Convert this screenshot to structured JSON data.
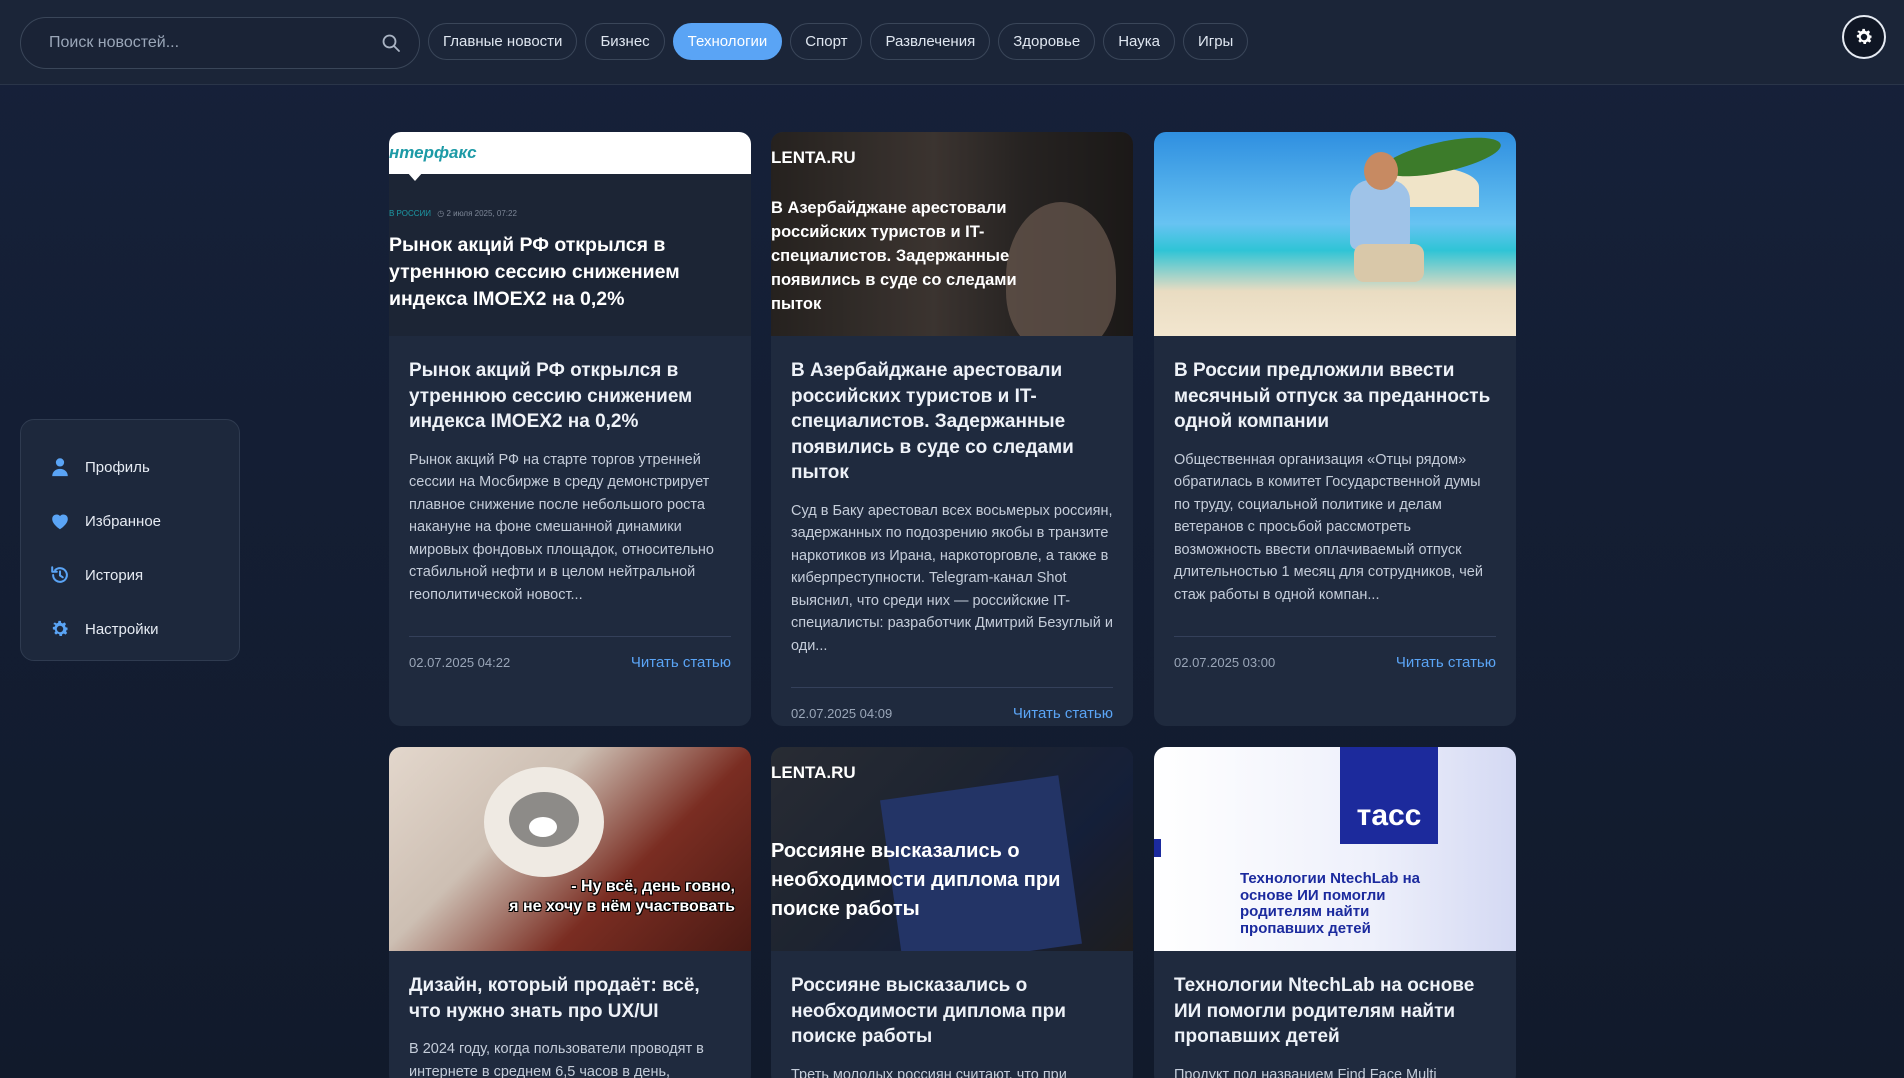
{
  "search": {
    "placeholder": "Поиск новостей..."
  },
  "tabs": [
    {
      "label": "Главные новости"
    },
    {
      "label": "Бизнес"
    },
    {
      "label": "Технологии"
    },
    {
      "label": "Спорт"
    },
    {
      "label": "Развлечения"
    },
    {
      "label": "Здоровье"
    },
    {
      "label": "Наука"
    },
    {
      "label": "Игры"
    }
  ],
  "active_tab": "Технологии",
  "colors": {
    "accent": "#5aa4f5",
    "background": "#131c2e",
    "card": "#1f2a3e"
  },
  "sidebar": {
    "items": [
      {
        "label": "Профиль",
        "icon": "user-icon"
      },
      {
        "label": "Избранное",
        "icon": "heart-icon"
      },
      {
        "label": "История",
        "icon": "history-icon"
      },
      {
        "label": "Настройки",
        "icon": "gear-icon"
      }
    ]
  },
  "cards": [
    {
      "thumb": {
        "logo": "нтерфакс",
        "meta_tag": "В РОССИИ",
        "meta_date": "2 июля 2025, 07:22",
        "headline": "Рынок акций РФ открылся в утреннюю сессию снижением индекса IMOEX2 на 0,2%"
      },
      "title": "Рынок акций РФ открылся в утреннюю сессию снижением индекса IMOEX2 на 0,2%",
      "text": "Рынок акций РФ на старте торгов утренней сессии на Мосбирже в среду демонстрирует плавное снижение после небольшого роста накануне на фоне смешанной динамики мировых фондовых площадок, относительно стабильной нефти и в целом нейтральной геополитической новост...",
      "date": "02.07.2025 04:22",
      "link": "Читать статью"
    },
    {
      "thumb": {
        "logo": "LENTA.RU",
        "headline": "В Азербайджане арестовали российских туристов и IT-специалистов. Задержанные появились в суде со следами пыток"
      },
      "title": "В Азербайджане арестовали российских туристов и IT-специалистов. Задержанные появились в суде со следами пыток",
      "text": "Суд в Баку арестовал всех восьмерых россиян, задержанных по подозрению якобы в транзите наркотиков из Ирана, наркоторговле, а также в киберпреступности. Telegram-канал Shot выяснил, что среди них — российские IT-специалисты: разработчик Дмитрий Безуглый и оди...",
      "date": "02.07.2025 04:09",
      "link": "Читать статью"
    },
    {
      "thumb": {},
      "title": "В России предложили ввести месячный отпуск за преданность одной компании",
      "text": "Общественная организация «Отцы рядом» обратилась в комитет Государственной думы по труду, социальной политике и делам ветеранов с просьбой рассмотреть возможность ввести оплачиваемый отпуск длительностью 1 месяц для сотрудников, чей стаж работы в одной компан...",
      "date": "02.07.2025 03:00",
      "link": "Читать статью"
    },
    {
      "thumb": {
        "caption": "- Ну всё, день говно,\nя не хочу в нём участвовать"
      },
      "title": "Дизайн, который продаёт: всё, что нужно знать про UX/UI",
      "text": "В 2024 году, когда пользователи проводят в интернете в среднем 6,5 часов в день,"
    },
    {
      "thumb": {
        "logo": "LENTA.RU",
        "headline": "Россияне высказались о необходимости диплома при поиске работы"
      },
      "title": "Россияне высказались о необходимости диплома при поиске работы",
      "text": "Треть молодых россиян считают, что при"
    },
    {
      "thumb": {
        "logo": "ТАСС",
        "headline": "Технологии NtechLab на основе ИИ помогли родителям найти пропавших детей"
      },
      "title": "Технологии NtechLab на основе ИИ помогли родителям найти пропавших детей",
      "text": "Продукт под названием Find Face Multi"
    }
  ]
}
